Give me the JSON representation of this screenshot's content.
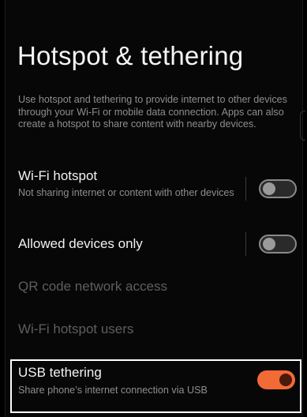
{
  "header": {
    "title": "Hotspot & tethering"
  },
  "description": "Use hotspot and tethering to provide internet to other devices through your Wi-Fi or mobile data connection. Apps can also create a hotspot to share content with nearby devices.",
  "settings": [
    {
      "title": "Wi-Fi hotspot",
      "subtitle": "Not sharing internet or content with other devices",
      "toggle": "off"
    },
    {
      "title": "Allowed devices only",
      "toggle": "off"
    },
    {
      "title": "QR code network access",
      "enabled": false
    },
    {
      "title": "Wi-Fi hotspot users",
      "enabled": false
    },
    {
      "title": "USB tethering",
      "subtitle": "Share phone’s internet connection via USB",
      "toggle": "on"
    }
  ],
  "colors": {
    "accent": "#f26a35",
    "background": "#070707",
    "highlight_outline": "#ffffff"
  }
}
